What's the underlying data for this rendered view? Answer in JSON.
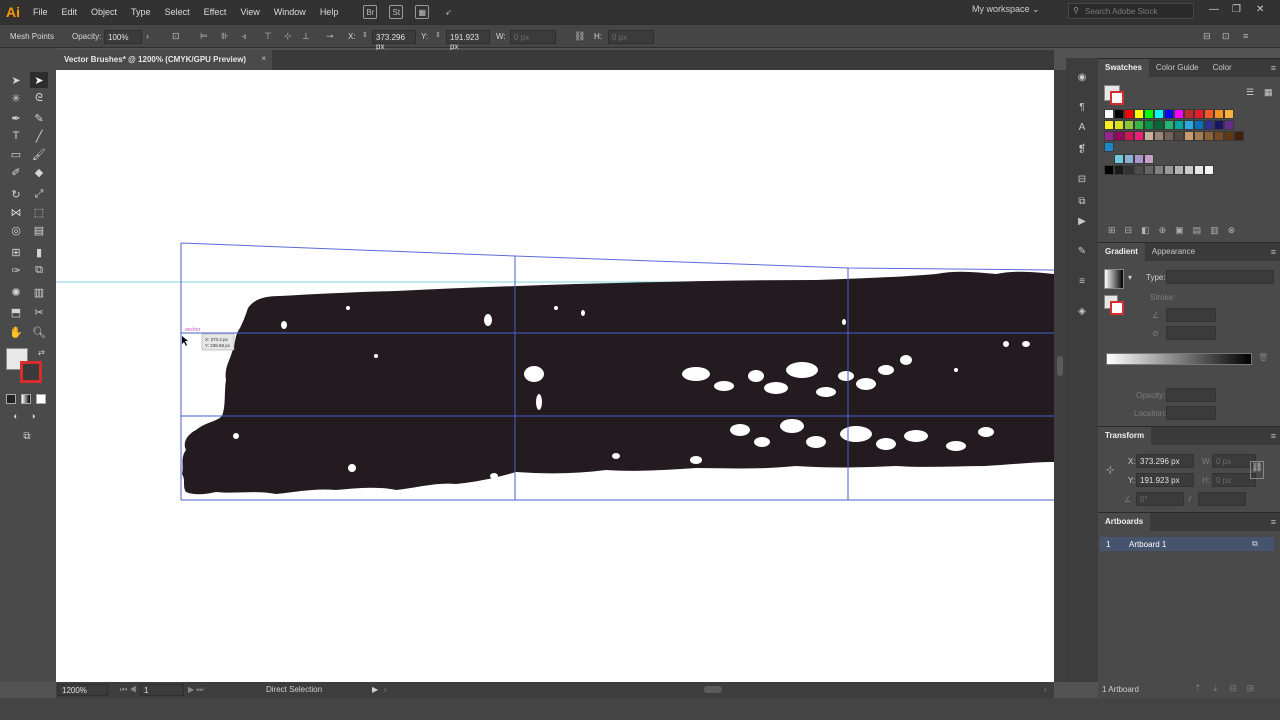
{
  "app": {
    "logo": "Ai"
  },
  "menus": [
    "File",
    "Edit",
    "Object",
    "Type",
    "Select",
    "Effect",
    "View",
    "Window",
    "Help"
  ],
  "menubar_icons": {
    "bridge": "Br",
    "stock": "St"
  },
  "workspace": "My workspace",
  "search_stock_placeholder": "Search Adobe Stock",
  "control": {
    "mode": "Mesh Points",
    "opacity_label": "Opacity:",
    "opacity_value": "100%",
    "x_label": "X:",
    "x_value": "373.296 px",
    "y_label": "Y:",
    "y_value": "191.923 px",
    "w_label": "W:",
    "w_value": "0 px",
    "h_label": "H:",
    "h_value": "0 px"
  },
  "document_tab": {
    "title": "Vector Brushes* @ 1200% (CMYK/GPU Preview)",
    "close": "×"
  },
  "canvas": {
    "anchor_label": "anchor",
    "tooltip_x": "X: 373.3 px",
    "tooltip_y": "Y: 236.68 px"
  },
  "status": {
    "zoom": "1200%",
    "artboard_num": "1",
    "tool": "Direct Selection"
  },
  "panels": {
    "swatches_tabs": [
      "Swatches",
      "Color Guide",
      "Color"
    ],
    "gradient_tabs": [
      "Gradient",
      "Appearance"
    ],
    "gradient_type_label": "Type:",
    "gradient_stroke_label": "Stroke:",
    "gradient_opacity_label": "Opacity:",
    "gradient_location_label": "Location:",
    "transform_title": "Transform",
    "transform_x_label": "X:",
    "transform_x": "373.296 px",
    "transform_y_label": "Y:",
    "transform_y": "191.923 px",
    "transform_w_label": "W:",
    "transform_w": "0 px",
    "transform_h_label": "H:",
    "transform_h": "0 px",
    "transform_angle": "0°",
    "artboards_title": "Artboards",
    "artboard_index": "1",
    "artboard_name": "Artboard 1",
    "artboards_count": "1 Artboard"
  },
  "colors": {
    "swatch_row1": [
      "#ffffff",
      "#000000",
      "#ff0000",
      "#ffff00",
      "#00ff00",
      "#00ffff",
      "#0000ff",
      "#ff00ff",
      "#c1272d",
      "#ed1c24",
      "#f15a24",
      "#f7931e",
      "#fbb03b"
    ],
    "swatch_row2": [
      "#fcee21",
      "#d9e021",
      "#8cc63f",
      "#39b54a",
      "#009245",
      "#006837",
      "#22b573",
      "#00a99d",
      "#29abe2",
      "#0071bc",
      "#2e3192",
      "#1b1464",
      "#662d91"
    ],
    "swatch_row3": [
      "#93278f",
      "#9e005d",
      "#d4145a",
      "#ed1e79",
      "#c7b299",
      "#998675",
      "#736357",
      "#534741",
      "#c69c6d",
      "#a67c52",
      "#8c6239",
      "#754c24",
      "#603813",
      "#42210b"
    ],
    "gray_row": [
      "#000000",
      "#1a1a1a",
      "#333333",
      "#4d4d4d",
      "#666666",
      "#808080",
      "#999999",
      "#b3b3b3",
      "#cccccc",
      "#e6e6e6",
      "#f2f2f2"
    ],
    "brush_fill": "#231b20",
    "guide_blue": "#4a5fd1",
    "guide_cyan": "#7fd6e6"
  }
}
